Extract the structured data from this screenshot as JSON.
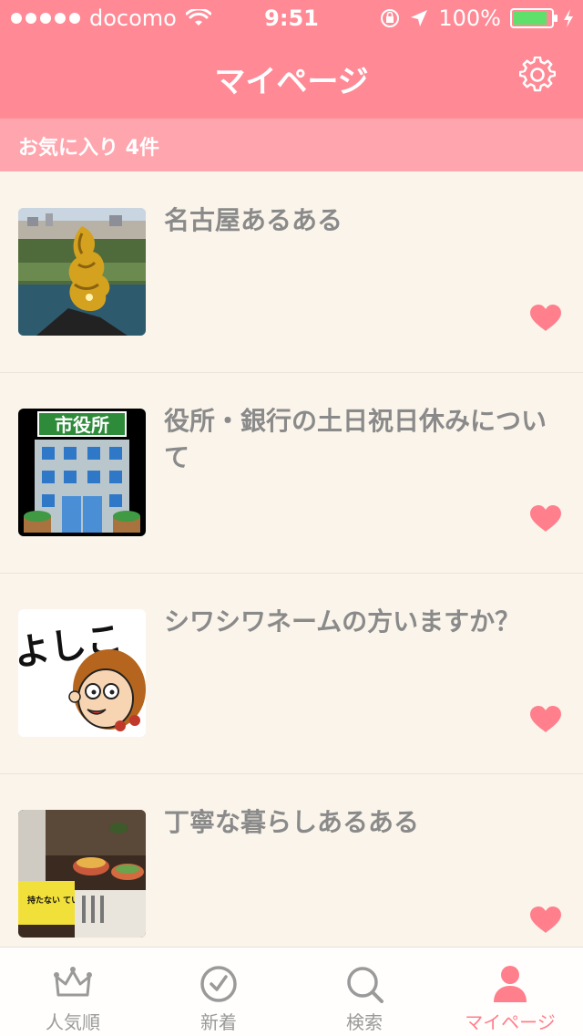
{
  "status_bar": {
    "carrier": "docomo",
    "time": "9:51",
    "battery": "100%",
    "battery_level": 1.0
  },
  "nav": {
    "title": "マイページ",
    "settings_icon": "gear-icon"
  },
  "favorites": {
    "label": "お気に入り 4件"
  },
  "items": [
    {
      "title": "名古屋あるある",
      "thumb_icon": "nagoya-castle-image",
      "favorite_icon": "heart-icon"
    },
    {
      "title": "役所・銀行の土日祝日休みについて",
      "thumb_icon": "city-hall-image",
      "thumb_text": "市役所",
      "favorite_icon": "heart-icon"
    },
    {
      "title": "シワシワネームの方いますか？",
      "thumb_icon": "cartoon-face-image",
      "thumb_text": "よしこ",
      "favorite_icon": "heart-icon"
    },
    {
      "title": "丁寧な暮らしあるある",
      "thumb_icon": "food-table-image",
      "thumb_text": "持たない ていねいな 暮らし",
      "favorite_icon": "heart-icon"
    }
  ],
  "tabs": [
    {
      "label": "人気順",
      "icon": "crown-icon"
    },
    {
      "label": "新着",
      "icon": "clock-icon"
    },
    {
      "label": "検索",
      "icon": "search-icon"
    },
    {
      "label": "マイページ",
      "icon": "person-icon"
    }
  ],
  "colors": {
    "header": "#ff8a95",
    "section": "#ffa5ad",
    "background": "#faf4ea",
    "heart": "#ff7f8c",
    "active_tab": "#ff7f8c"
  }
}
